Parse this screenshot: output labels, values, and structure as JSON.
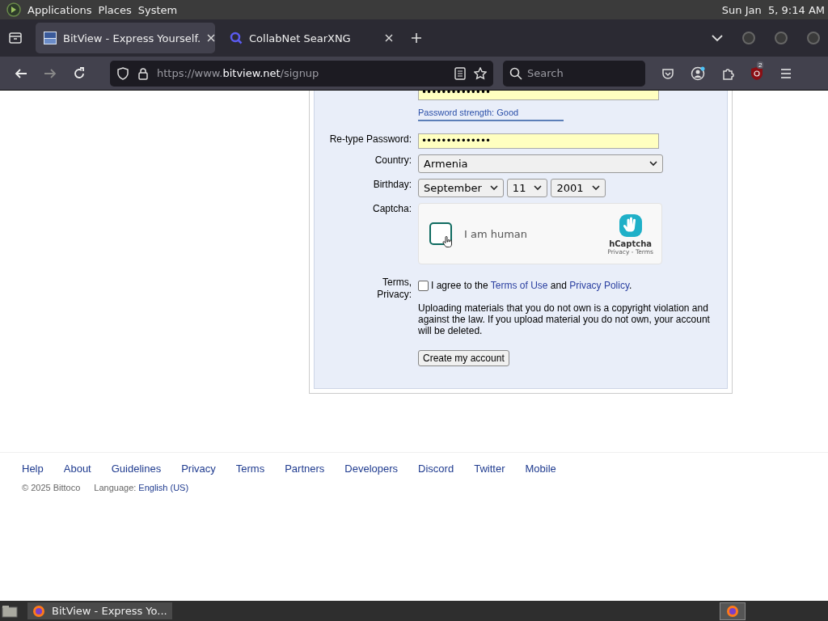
{
  "top_panel": {
    "menus": [
      "Applications",
      "Places",
      "System"
    ],
    "clock": "Sun Jan  5, 9:14 AM"
  },
  "tabs": [
    {
      "title": "BitView - Express Yourself.",
      "selected": true
    },
    {
      "title": "CollabNet SearXNG",
      "selected": false
    }
  ],
  "toolbar": {
    "url_prefix": "https://www.",
    "url_domain": "bitview.net",
    "url_path": "/signup",
    "search_placeholder": "Search",
    "extension_badge": "2"
  },
  "form": {
    "password": {
      "value": "••••••••••••••",
      "strength": "Password strength: Good"
    },
    "fields": [
      {
        "kind": "password",
        "label": "Re-type Password:",
        "value": "••••••••••••••"
      },
      {
        "kind": "select",
        "label": "Country:",
        "options": [
          "Armenia"
        ]
      },
      {
        "kind": "select",
        "label": "Birthday:",
        "options": [
          "September",
          "11",
          "2001"
        ]
      },
      {
        "kind": "captcha",
        "label": "Captcha:",
        "checkbox_label": "I am human",
        "brand": "hCaptcha",
        "links": "Privacy - Terms",
        "checked": false
      },
      {
        "kind": "terms",
        "label": "Terms,\nPrivacy:",
        "checked": false,
        "text": [
          "I agree to the ",
          "Terms of Use",
          " and ",
          "Privacy Policy",
          "."
        ],
        "notice": "Uploading materials that you do not own is a copyright violation and against the law. If you upload material you do not own, your account will be deleted."
      }
    ],
    "submit": "Create my account"
  },
  "footer": {
    "links": [
      "Help",
      "About",
      "Guidelines",
      "Privacy",
      "Terms",
      "Partners",
      "Developers",
      "Discord",
      "Twitter",
      "Mobile"
    ],
    "copyright": "© 2025 Bittoco",
    "language_label": "Language:",
    "language": "English (US)"
  },
  "taskbar": {
    "window": "BitView - Express Yo..."
  }
}
